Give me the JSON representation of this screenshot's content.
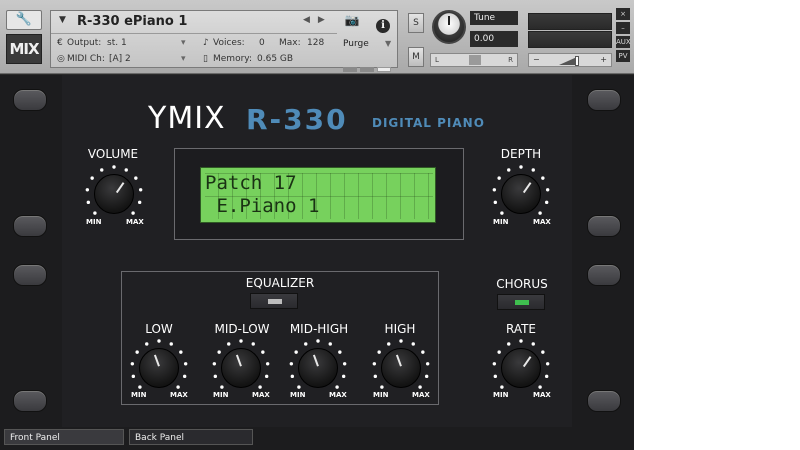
{
  "header": {
    "instrument_name": "R-330 ePiano 1",
    "output_label": "Output:",
    "output_value": "st. 1",
    "voices_label": "Voices:",
    "voices_value": "0",
    "max_label": "Max:",
    "max_value": "128",
    "midi_label": "MIDI Ch:",
    "midi_value": "[A]  2",
    "memory_label": "Memory:",
    "memory_value": "0.65 GB",
    "purge_label": "Purge",
    "s_label": "S",
    "m_label": "M",
    "tune_label": "Tune",
    "tune_value": "0.00",
    "pan_left": "L",
    "pan_right": "R",
    "vol_minus": "−",
    "vol_plus": "+",
    "side_buttons": [
      "×",
      "–",
      "AUX",
      "PV"
    ],
    "logo_text": "MIX"
  },
  "panel": {
    "brand": "YMIX",
    "model": "R-330",
    "subtitle": "DIGITAL PIANO",
    "lcd_line1": "Patch 17",
    "lcd_line2": " E.Piano 1",
    "knobs": {
      "volume": "VOLUME",
      "depth": "DEPTH",
      "low": "LOW",
      "mid_low": "MID-LOW",
      "mid_high": "MID-HIGH",
      "high": "HIGH",
      "rate": "RATE"
    },
    "min_label": "MIN",
    "max_label": "MAX",
    "equalizer": "EQUALIZER",
    "chorus": "CHORUS"
  },
  "footer": {
    "front_tab": "Front Panel",
    "back_tab": "Back Panel"
  },
  "colors": {
    "lcd_bg": "#77d15d",
    "accent_blue": "#4f8bb8",
    "chorus_led": "#3fbf4f"
  }
}
